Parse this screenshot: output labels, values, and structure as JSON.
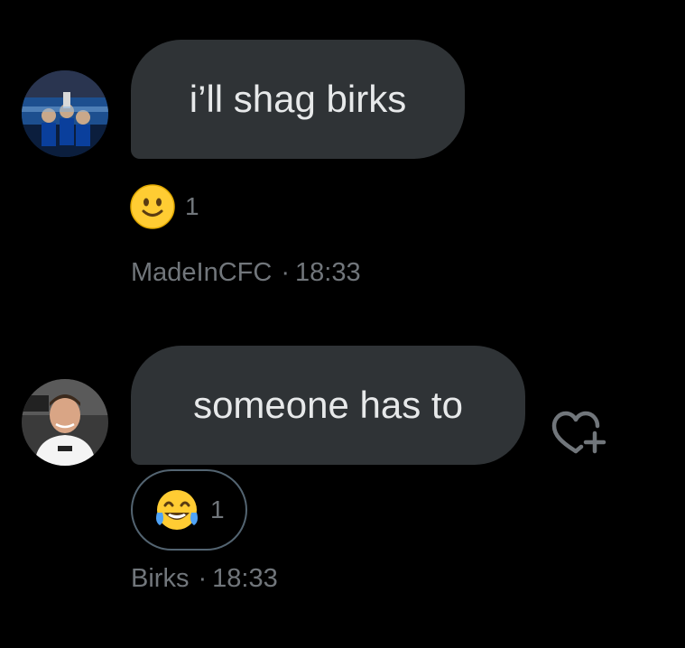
{
  "messages": [
    {
      "text": "i’ll shag birks",
      "reaction": {
        "emoji": "slightly-smiling-face",
        "count": "1"
      },
      "author": "MadeInCFC",
      "separator": "·",
      "time": "18:33"
    },
    {
      "text": "someone has to",
      "reaction": {
        "emoji": "face-with-tears-of-joy",
        "count": "1"
      },
      "author": "Birks",
      "separator": "·",
      "time": "18:33"
    }
  ],
  "actions": {
    "add_reaction_icon": "heart-plus-icon"
  },
  "colors": {
    "background": "#000000",
    "bubble": "#2f3336",
    "text": "#e7e9ea",
    "muted": "#71767b",
    "pill_border": "#536471"
  }
}
